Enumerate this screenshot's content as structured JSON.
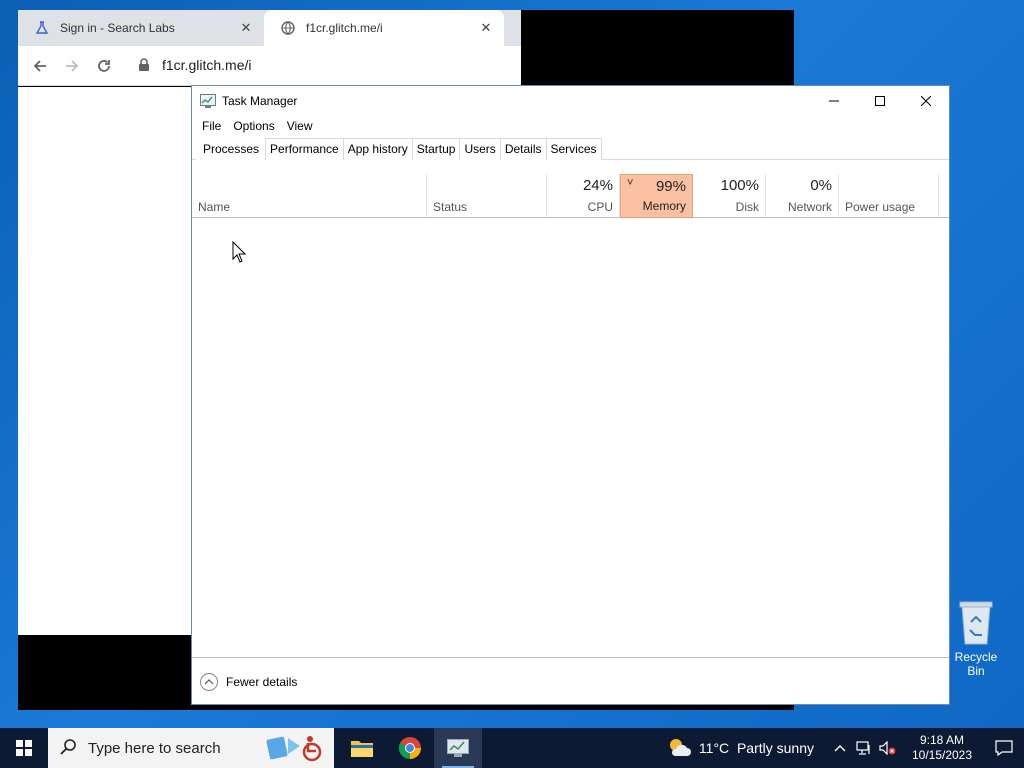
{
  "browser": {
    "tabs": [
      {
        "label": "Sign in - Search Labs",
        "icon": "flask-icon"
      },
      {
        "label": "f1cr.glitch.me/i",
        "icon": "globe-icon"
      }
    ],
    "close_glyph": "✕",
    "address": "f1cr.glitch.me/i"
  },
  "task_manager": {
    "title": "Task Manager",
    "menu": [
      "File",
      "Options",
      "View"
    ],
    "tabs": [
      "Processes",
      "Performance",
      "App history",
      "Startup",
      "Users",
      "Details",
      "Services"
    ],
    "active_tab": "Processes",
    "columns": {
      "name": {
        "label": "Name"
      },
      "status": {
        "label": "Status"
      },
      "cpu": {
        "label": "CPU",
        "value": "24%"
      },
      "memory": {
        "label": "Memory",
        "value": "99%",
        "sort_glyph": "˅"
      },
      "disk": {
        "label": "Disk",
        "value": "100%"
      },
      "network": {
        "label": "Network",
        "value": "0%"
      },
      "power": {
        "label": "Power usage"
      }
    },
    "fewer_details": "Fewer details"
  },
  "desktop": {
    "recycle_bin": "Recycle Bin"
  },
  "taskbar": {
    "search_placeholder": "Type here to search",
    "weather": {
      "temp": "11°C",
      "desc": "Partly sunny"
    },
    "clock": {
      "time": "9:18 AM",
      "date": "10/15/2023"
    }
  },
  "colors": {
    "highlight": "#f9c0a2",
    "taskbar": "#0c1b33",
    "desktop": "#1a7ad6"
  }
}
